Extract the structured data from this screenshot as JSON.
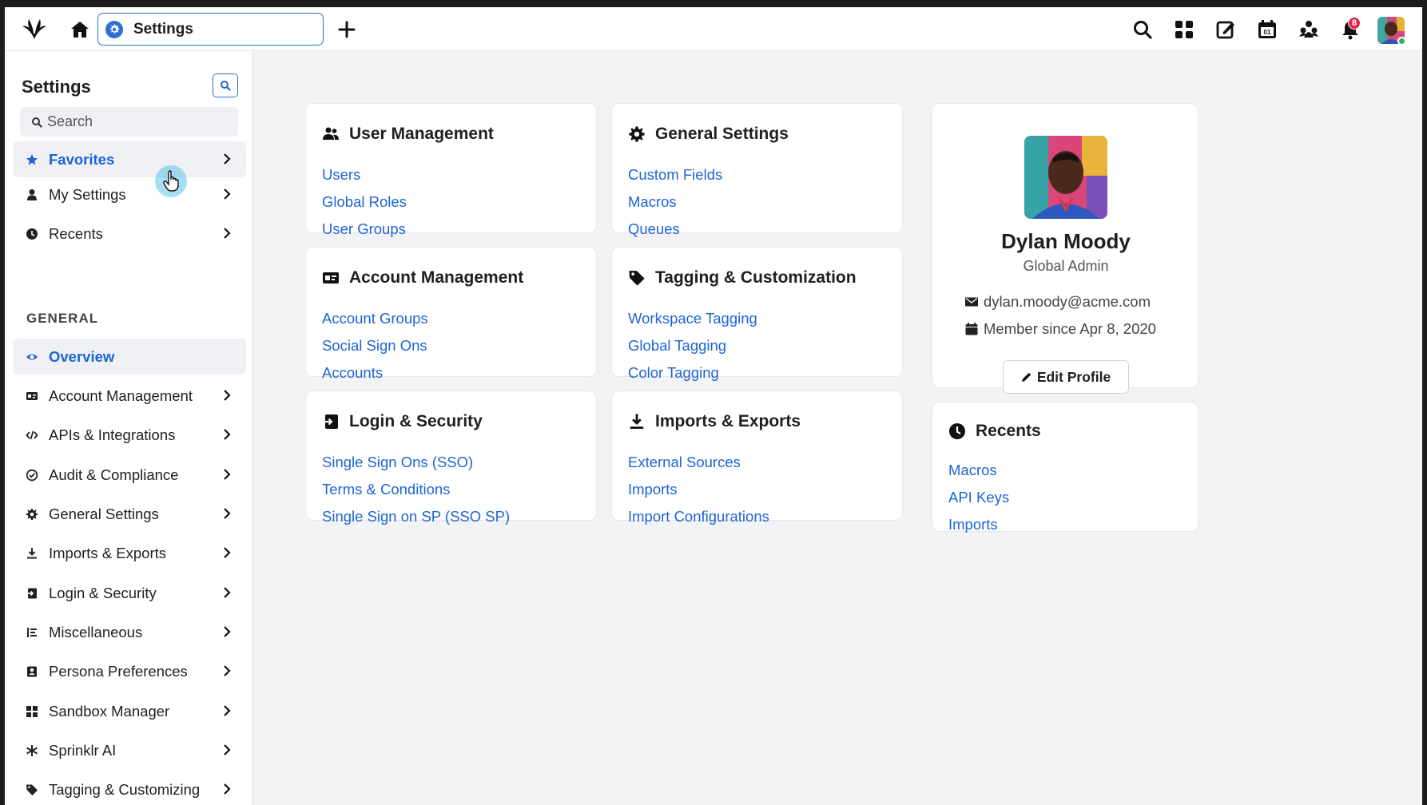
{
  "topbar": {
    "tab_title": "Settings",
    "notification_count": "8"
  },
  "sidebar": {
    "title": "Settings",
    "search_placeholder": "Search",
    "top_items": [
      {
        "label": "Favorites",
        "icon": "star-icon",
        "active": true
      },
      {
        "label": "My Settings",
        "icon": "person-icon"
      },
      {
        "label": "Recents",
        "icon": "clock-icon"
      }
    ],
    "section_label": "GENERAL",
    "general_items": [
      {
        "label": "Overview",
        "icon": "eye-icon",
        "active": true
      },
      {
        "label": "Account Management",
        "icon": "id-card-icon"
      },
      {
        "label": "APIs & Integrations",
        "icon": "code-icon"
      },
      {
        "label": "Audit & Compliance",
        "icon": "check-circle-icon"
      },
      {
        "label": "General Settings",
        "icon": "gear-icon"
      },
      {
        "label": "Imports & Exports",
        "icon": "download-icon"
      },
      {
        "label": "Login & Security",
        "icon": "login-icon"
      },
      {
        "label": "Miscellaneous",
        "icon": "list-icon"
      },
      {
        "label": "Persona Preferences",
        "icon": "persona-icon"
      },
      {
        "label": "Sandbox Manager",
        "icon": "grid-icon"
      },
      {
        "label": "Sprinklr AI",
        "icon": "asterisk-icon"
      },
      {
        "label": "Tagging & Customizing",
        "icon": "tag-icon"
      }
    ]
  },
  "cards": {
    "user_management": {
      "title": "User Management",
      "links": [
        "Users",
        "Global Roles",
        "User Groups"
      ]
    },
    "general_settings": {
      "title": "General Settings",
      "links": [
        "Custom Fields",
        "Macros",
        "Queues"
      ]
    },
    "account_management": {
      "title": "Account Management",
      "links": [
        "Account Groups",
        "Social Sign Ons",
        "Accounts"
      ]
    },
    "tagging": {
      "title": "Tagging & Customization",
      "links": [
        "Workspace Tagging",
        "Global Tagging",
        "Color Tagging"
      ]
    },
    "login_security": {
      "title": "Login & Security",
      "links": [
        "Single Sign Ons (SSO)",
        "Terms & Conditions",
        "Single Sign on SP (SSO SP)"
      ]
    },
    "imports_exports": {
      "title": "Imports & Exports",
      "links": [
        "External Sources",
        "Imports",
        "Import Configurations"
      ]
    }
  },
  "profile": {
    "name": "Dylan Moody",
    "role": "Global Admin",
    "email": "dylan.moody@acme.com",
    "member_since": "Member since Apr 8, 2020",
    "edit_label": "Edit Profile"
  },
  "recents": {
    "title": "Recents",
    "links": [
      "Macros",
      "API Keys",
      "Imports"
    ]
  },
  "colors": {
    "accent": "#1d64d6",
    "badge": "#e2254b",
    "background": "#f2f3f5"
  }
}
